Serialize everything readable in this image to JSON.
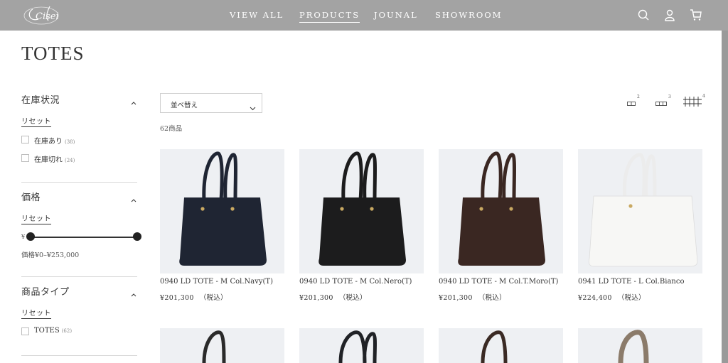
{
  "header": {
    "logo_text": "Cisei",
    "nav": [
      {
        "label": "VIEW ALL",
        "active": false
      },
      {
        "label": "PRODUCTS",
        "active": true
      },
      {
        "label": "JOUNAL",
        "active": false
      },
      {
        "label": "SHOWROOM",
        "active": false
      }
    ],
    "icons": [
      "search-icon",
      "account-icon",
      "cart-icon"
    ],
    "background": "#a3a3a3"
  },
  "page": {
    "title": "TOTES"
  },
  "filters": {
    "availability": {
      "title": "在庫状況",
      "reset": "リセット",
      "options": [
        {
          "label": "在庫あり",
          "count": "(38)",
          "checked": false
        },
        {
          "label": "在庫切れ",
          "count": "(24)",
          "checked": false
        }
      ]
    },
    "price": {
      "title": "価格",
      "reset": "リセット",
      "currency": "¥",
      "range_text": "価格¥0–¥253,000",
      "min": 0,
      "max": 253000,
      "selected_min": 0,
      "selected_max": 253000
    },
    "product_type": {
      "title": "商品タイプ",
      "reset": "リセット",
      "options": [
        {
          "label": "TOTES",
          "count": "(62)",
          "checked": false
        }
      ]
    }
  },
  "toolbar": {
    "sort_label": "並べ替え",
    "count_label": "62商品",
    "grid_options": [
      {
        "columns": "2"
      },
      {
        "columns": "3"
      },
      {
        "columns": "4",
        "active": true
      }
    ]
  },
  "products": [
    {
      "title": "0940 LD TOTE - M Col.Navy(T)",
      "price": "¥201,300",
      "tax": "（税込）",
      "color": "#1f2533"
    },
    {
      "title": "0940 LD TOTE - M Col.Nero(T)",
      "price": "¥201,300",
      "tax": "（税込）",
      "color": "#1c1c1d"
    },
    {
      "title": "0940 LD TOTE - M Col.T.Moro(T)",
      "price": "¥201,300",
      "tax": "（税込）",
      "color": "#3a2722"
    },
    {
      "title": "0941 LD TOTE - L Col.Bianco",
      "price": "¥224,400",
      "tax": "（税込）",
      "color": "#f7f7f5"
    }
  ],
  "products_row2_colors": [
    "#2a2a2a",
    "#202226",
    "#3a2a24",
    "#8b7b6a"
  ]
}
